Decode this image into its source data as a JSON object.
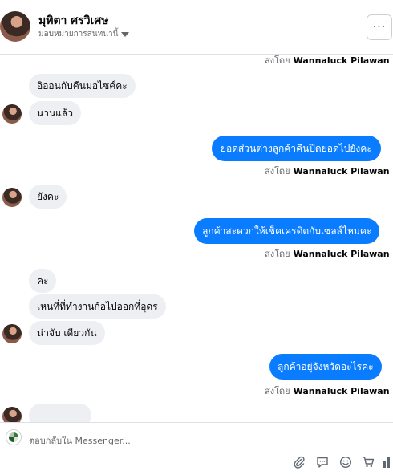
{
  "header": {
    "contact_name": "มุทิตา ศรวิเศษ",
    "assigned_label": "มอบหมายการสนทนานี้",
    "more_label": "···"
  },
  "sent_by_prefix": "ส่งโดย",
  "agent_name": "Wannaluck Pilawan",
  "messages": {
    "in1": "อิออนกับคืนมอไซค์คะ",
    "in2": "นานแล้ว",
    "out1": "ยอดส่วนต่างลูกค้าคืนปิดยอดไปยังคะ",
    "in3": "ยังคะ",
    "out2": "ลูกค้าสะดวกให้เช็คเครดิตกับเซลส์ไหมคะ",
    "in4": "คะ",
    "in5": "เหนที่ที่ทำงานก้อไปออกที่อุดร",
    "in6": "น่าจับ เดียวกัน",
    "out3": "ลูกค้าอยู่จังหวัดอะไรคะ"
  },
  "composer": {
    "placeholder": "ตอบกลับใน Messenger..."
  },
  "colors": {
    "outgoing_bubble": "#0a7cff",
    "incoming_bubble": "#eeeff2",
    "toolbar_icon": "#606770"
  },
  "icons": [
    "paperclip-icon",
    "saved-reply-icon",
    "emoji-icon",
    "cart-icon",
    "stats-icon"
  ]
}
